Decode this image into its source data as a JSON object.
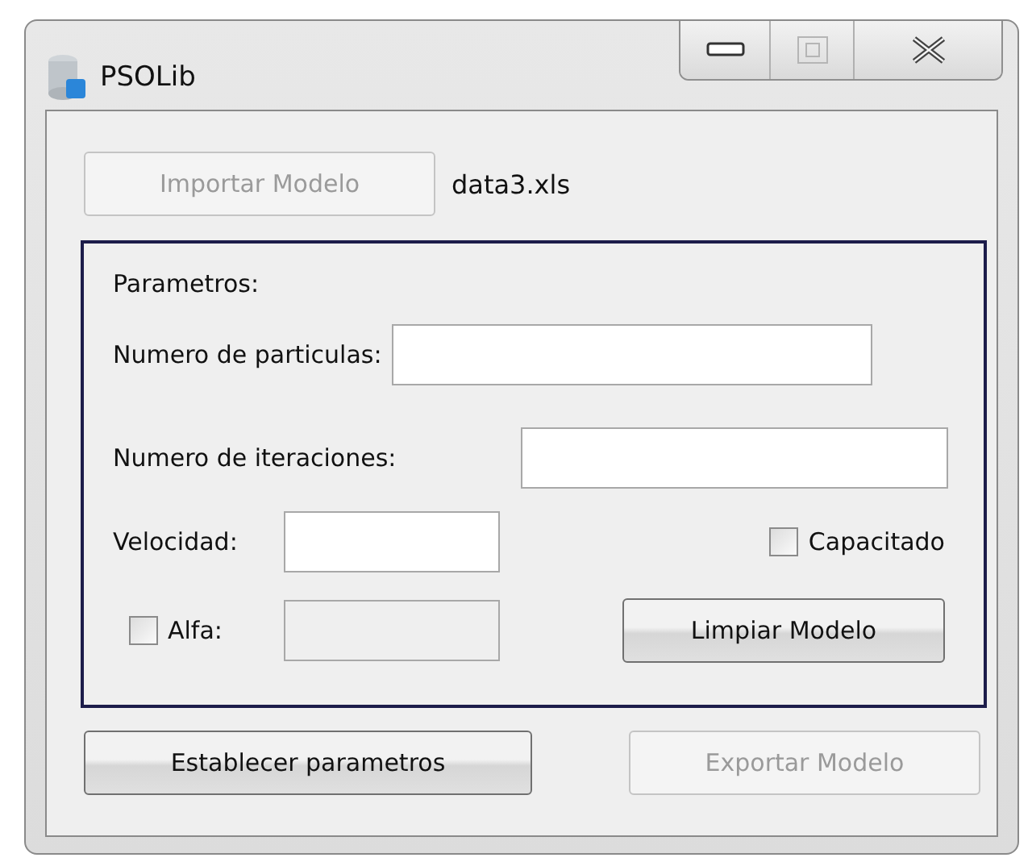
{
  "window": {
    "title": "PSOLib",
    "maximize_disabled": true
  },
  "import": {
    "button": {
      "label": "Importar Modelo",
      "disabled": true
    },
    "file": "data3.xls"
  },
  "params": {
    "heading": "Parametros:",
    "particles": {
      "label": "Numero de particulas:"
    },
    "iterations": {
      "label": "Numero de iteraciones:"
    },
    "velocity": {
      "label": "Velocidad:"
    },
    "capacitado": {
      "label": "Capacitado",
      "checked": false
    },
    "alfa": {
      "label": "Alfa:",
      "checked": false,
      "field_disabled": true
    },
    "clear": {
      "label": "Limpiar Modelo",
      "disabled": false
    }
  },
  "buttons": [
    {
      "label": "Establecer parametros",
      "disabled": false
    },
    {
      "label": "Exportar Modelo",
      "disabled": true
    }
  ]
}
